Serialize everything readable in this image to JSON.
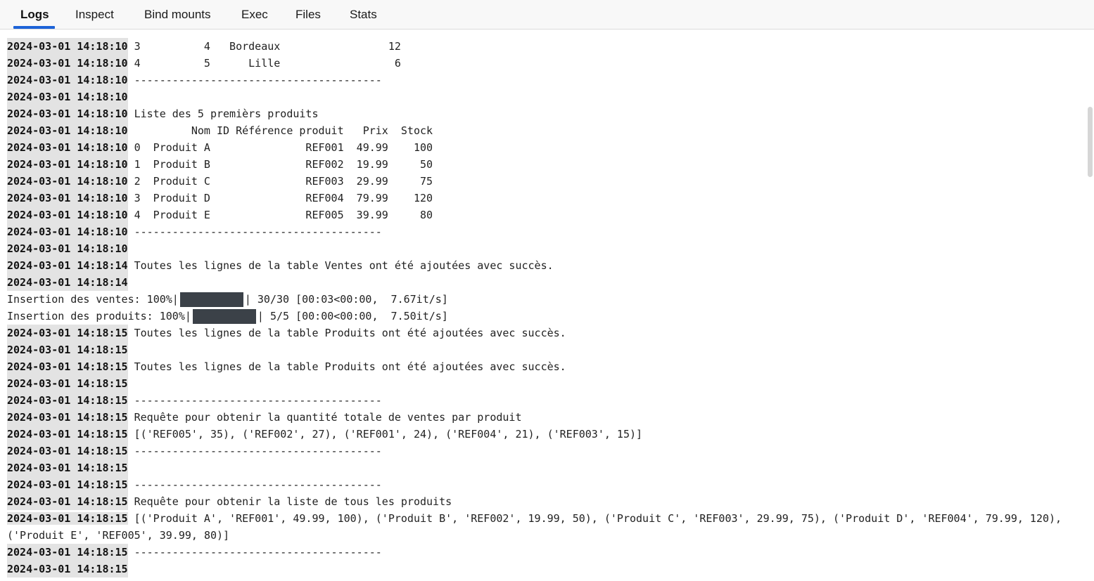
{
  "tabs": [
    {
      "label": "Logs",
      "active": true
    },
    {
      "label": "Inspect",
      "active": false
    },
    {
      "label": "Bind mounts",
      "active": false
    },
    {
      "label": "Exec",
      "active": false
    },
    {
      "label": "Files",
      "active": false
    },
    {
      "label": "Stats",
      "active": false
    }
  ],
  "accent_color": "#1d63d8",
  "log_lines": [
    {
      "ts": "2024-03-01 14:18:10",
      "msg": "3          4   Bordeaux                 12"
    },
    {
      "ts": "2024-03-01 14:18:10",
      "msg": "4          5      Lille                  6"
    },
    {
      "ts": "2024-03-01 14:18:10",
      "msg": "---------------------------------------"
    },
    {
      "ts": "2024-03-01 14:18:10",
      "msg": ""
    },
    {
      "ts": "2024-03-01 14:18:10",
      "msg": "Liste des 5 premièrs produits"
    },
    {
      "ts": "2024-03-01 14:18:10",
      "msg": "         Nom ID Référence produit   Prix  Stock"
    },
    {
      "ts": "2024-03-01 14:18:10",
      "msg": "0  Produit A               REF001  49.99    100"
    },
    {
      "ts": "2024-03-01 14:18:10",
      "msg": "1  Produit B               REF002  19.99     50"
    },
    {
      "ts": "2024-03-01 14:18:10",
      "msg": "2  Produit C               REF003  29.99     75"
    },
    {
      "ts": "2024-03-01 14:18:10",
      "msg": "3  Produit D               REF004  79.99    120"
    },
    {
      "ts": "2024-03-01 14:18:10",
      "msg": "4  Produit E               REF005  39.99     80"
    },
    {
      "ts": "2024-03-01 14:18:10",
      "msg": "---------------------------------------"
    },
    {
      "ts": "2024-03-01 14:18:10",
      "msg": ""
    },
    {
      "ts": "2024-03-01 14:18:14",
      "msg": "Toutes les lignes de la table Ventes ont été ajoutées avec succès."
    },
    {
      "ts": "2024-03-01 14:18:14",
      "msg": ""
    }
  ],
  "progress_lines": [
    {
      "prefix": "Insertion des ventes: 100%|",
      "suffix": "| 30/30 [00:03<00:00,  7.67it/s]",
      "progress": 1.0
    },
    {
      "prefix": "Insertion des produits: 100%|",
      "suffix": "| 5/5 [00:00<00:00,  7.50it/s]",
      "progress": 1.0
    }
  ],
  "log_lines_2": [
    {
      "ts": "2024-03-01 14:18:15",
      "msg": "Toutes les lignes de la table Produits ont été ajoutées avec succès."
    },
    {
      "ts": "2024-03-01 14:18:15",
      "msg": ""
    },
    {
      "ts": "2024-03-01 14:18:15",
      "msg": "Toutes les lignes de la table Produits ont été ajoutées avec succès."
    },
    {
      "ts": "2024-03-01 14:18:15",
      "msg": ""
    },
    {
      "ts": "2024-03-01 14:18:15",
      "msg": "---------------------------------------"
    },
    {
      "ts": "2024-03-01 14:18:15",
      "msg": "Requête pour obtenir la quantité totale de ventes par produit"
    },
    {
      "ts": "2024-03-01 14:18:15",
      "msg": "[('REF005', 35), ('REF002', 27), ('REF001', 24), ('REF004', 21), ('REF003', 15)]"
    },
    {
      "ts": "2024-03-01 14:18:15",
      "msg": "---------------------------------------"
    },
    {
      "ts": "2024-03-01 14:18:15",
      "msg": ""
    },
    {
      "ts": "2024-03-01 14:18:15",
      "msg": "---------------------------------------"
    },
    {
      "ts": "2024-03-01 14:18:15",
      "msg": "Requête pour obtenir la liste de tous les produits"
    }
  ],
  "wrapped_line": {
    "ts": "2024-03-01 14:18:15",
    "msg": "[('Produit A', 'REF001', 49.99, 100), ('Produit B', 'REF002', 19.99, 50), ('Produit C', 'REF003', 29.99, 75), ('Produit D', 'REF004', 79.99, 120), ('Produit E', 'REF005', 39.99, 80)]"
  },
  "log_lines_3": [
    {
      "ts": "2024-03-01 14:18:15",
      "msg": "---------------------------------------"
    },
    {
      "ts": "2024-03-01 14:18:15",
      "msg": ""
    }
  ]
}
